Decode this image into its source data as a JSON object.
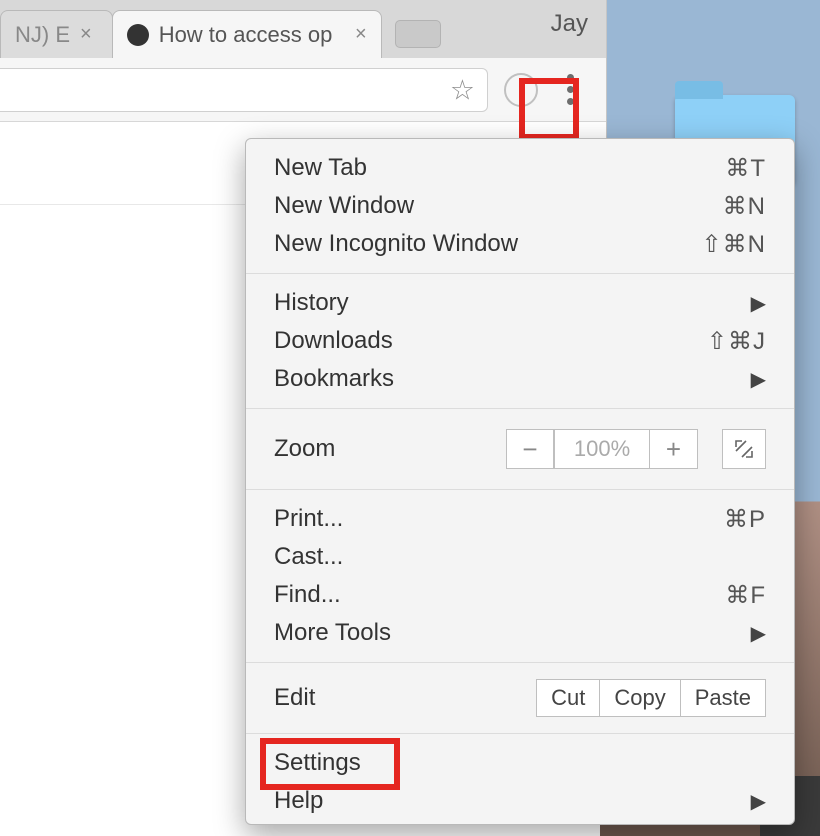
{
  "tabs": {
    "inactive_title": "NJ) E",
    "active_title": "How to access op"
  },
  "profile_name": "Jay",
  "menu": {
    "new_tab": {
      "label": "New Tab",
      "shortcut": "⌘T"
    },
    "new_window": {
      "label": "New Window",
      "shortcut": "⌘N"
    },
    "new_incognito": {
      "label": "New Incognito Window",
      "shortcut": "⇧⌘N"
    },
    "history": {
      "label": "History"
    },
    "downloads": {
      "label": "Downloads",
      "shortcut": "⇧⌘J"
    },
    "bookmarks": {
      "label": "Bookmarks"
    },
    "zoom": {
      "label": "Zoom",
      "value": "100%"
    },
    "print": {
      "label": "Print...",
      "shortcut": "⌘P"
    },
    "cast": {
      "label": "Cast..."
    },
    "find": {
      "label": "Find...",
      "shortcut": "⌘F"
    },
    "more_tools": {
      "label": "More Tools"
    },
    "edit": {
      "label": "Edit",
      "cut": "Cut",
      "copy": "Copy",
      "paste": "Paste"
    },
    "settings": {
      "label": "Settings"
    },
    "help": {
      "label": "Help"
    }
  }
}
